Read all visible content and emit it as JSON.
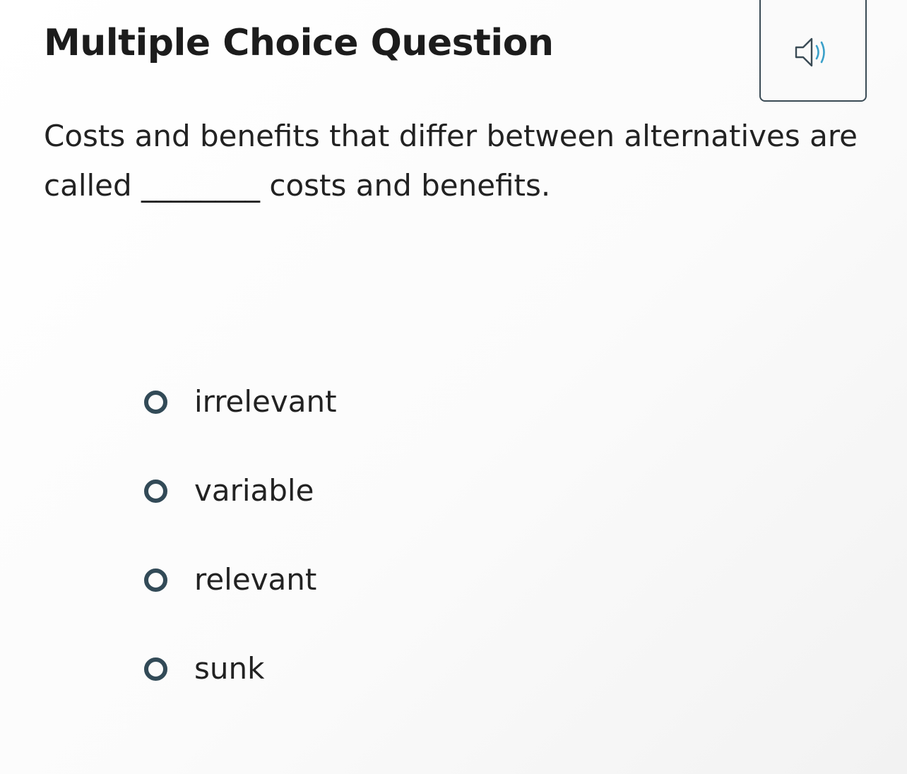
{
  "header": {
    "title": "Multiple Choice Question",
    "audio_icon": "speaker-icon"
  },
  "question": {
    "text_before": "Costs and benefits that differ between alternatives are called ",
    "blank": "________",
    "text_after": " costs and benefits."
  },
  "choices": [
    {
      "label": "irrelevant"
    },
    {
      "label": "variable"
    },
    {
      "label": "relevant"
    },
    {
      "label": "sunk"
    }
  ],
  "colors": {
    "radio_border": "#324a57",
    "speaker_stroke": "#3a4b55",
    "speaker_waves": "#3aa0c9"
  }
}
